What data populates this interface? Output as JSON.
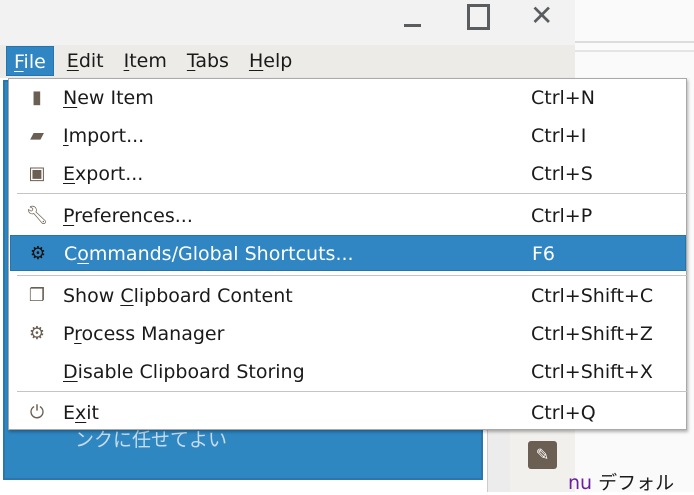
{
  "window": {
    "minimize": "minimize",
    "maximize": "maximize",
    "close": "✕"
  },
  "menubar": [
    {
      "key": "F",
      "post": "ile"
    },
    {
      "key": "E",
      "post": "dit"
    },
    {
      "key": "I",
      "post": "tem"
    },
    {
      "key": "T",
      "post": "abs"
    },
    {
      "key": "H",
      "post": "elp"
    }
  ],
  "file_menu": [
    {
      "icon": "document-icon",
      "pre": "",
      "key": "N",
      "post": "ew Item",
      "shortcut": "Ctrl+N"
    },
    {
      "icon": "folder-open-icon",
      "pre": "",
      "key": "I",
      "post": "mport...",
      "shortcut": "Ctrl+I"
    },
    {
      "icon": "save-icon",
      "pre": "",
      "key": "E",
      "post": "xport...",
      "shortcut": "Ctrl+S"
    },
    {
      "icon": "wrench-icon",
      "pre": "",
      "key": "P",
      "post": "references...",
      "shortcut": "Ctrl+P"
    },
    {
      "icon": "gear-icon",
      "pre": "C",
      "key": "o",
      "post": "mmands/Global Shortcuts...",
      "shortcut": "F6"
    },
    {
      "icon": "clipboard-icon",
      "pre": "Show ",
      "key": "C",
      "post": "lipboard Content",
      "shortcut": "Ctrl+Shift+C"
    },
    {
      "icon": "gears-icon",
      "pre": "P",
      "key": "r",
      "post": "ocess Manager",
      "shortcut": "Ctrl+Shift+Z"
    },
    {
      "icon": "",
      "pre": "",
      "key": "D",
      "post": "isable Clipboard Storing",
      "shortcut": "Ctrl+Shift+X"
    },
    {
      "icon": "power-icon",
      "pre": "E",
      "key": "x",
      "post": "it",
      "shortcut": "Ctrl+Q"
    }
  ],
  "background": {
    "blue_text": "ンクに任せてよい",
    "right_kw": "nu",
    "right_text": " デフォル"
  },
  "colors": {
    "accent": "#2f86c3",
    "icon": "#6b5e52"
  }
}
